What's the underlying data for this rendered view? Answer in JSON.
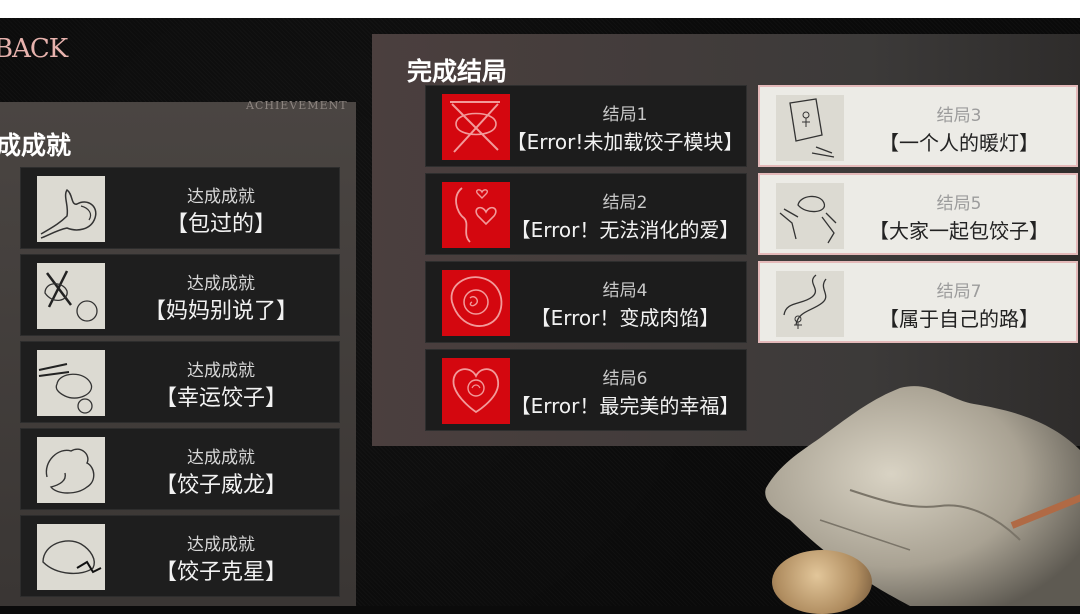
{
  "nav": {
    "back_label": "BACK"
  },
  "achievements": {
    "section_en": "ACHIEVEMENT",
    "title": "成成就",
    "items": [
      {
        "label": "达成成就",
        "name": "【包过的】",
        "icon": "dumpling-hand-sketch-icon"
      },
      {
        "label": "达成成就",
        "name": "【妈妈别说了】",
        "icon": "crossed-dumpling-sketch-icon"
      },
      {
        "label": "达成成就",
        "name": "【幸运饺子】",
        "icon": "chopsticks-dumpling-sketch-icon"
      },
      {
        "label": "达成成就",
        "name": "【饺子威龙】",
        "icon": "dragon-dumpling-sketch-icon"
      },
      {
        "label": "达成成就",
        "name": "【饺子克星】",
        "icon": "dumpling-crack-sketch-icon"
      }
    ]
  },
  "endings": {
    "title": "完成结局",
    "items": [
      {
        "label": "结局1",
        "name": "【Error!未加载饺子模块】",
        "icon": "error-crossed-dumpling-icon",
        "kind": "error"
      },
      {
        "label": "结局3",
        "name": "【一个人的暖灯】",
        "icon": "lamp-figure-sketch-icon",
        "kind": "normal"
      },
      {
        "label": "结局2",
        "name": "【Error！无法消化的爱】",
        "icon": "error-hearts-icon",
        "kind": "error"
      },
      {
        "label": "结局5",
        "name": "【大家一起包饺子】",
        "icon": "hands-dumpling-sketch-icon",
        "kind": "normal"
      },
      {
        "label": "结局4",
        "name": "【Error！变成肉馅】",
        "icon": "error-meat-filling-icon",
        "kind": "error"
      },
      {
        "label": "结局7",
        "name": "【属于自己的路】",
        "icon": "path-figure-sketch-icon",
        "kind": "normal"
      },
      {
        "label": "结局6",
        "name": "【Error！最完美的幸福】",
        "icon": "error-heart-baby-icon",
        "kind": "error"
      }
    ]
  },
  "colors": {
    "error_red": "#d4070f",
    "back_pink": "#e7b2ad",
    "card_dark": "#1e1e1e",
    "card_light": "#ecebe6"
  }
}
